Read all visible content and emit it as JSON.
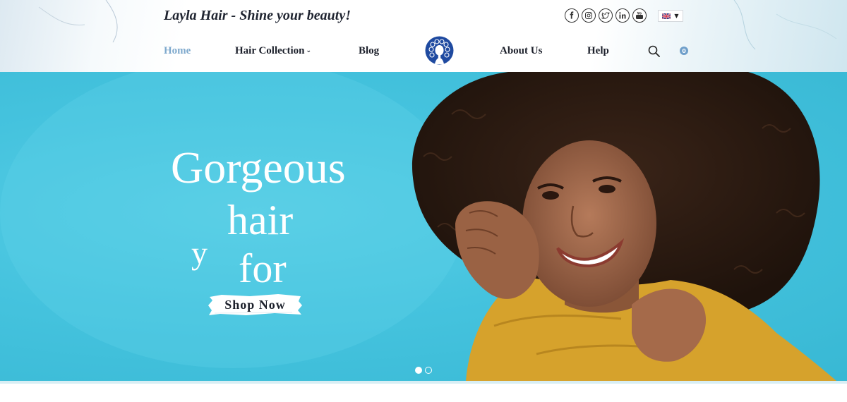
{
  "brand": {
    "tagline": "Layla Hair - Shine your beauty!",
    "logo_icon": "afro-woman-logo-icon",
    "brand_color": "#1f4aa0"
  },
  "social": [
    {
      "icon": "facebook-icon",
      "glyph": "f"
    },
    {
      "icon": "instagram-icon",
      "glyph": ""
    },
    {
      "icon": "twitter-icon",
      "glyph": ""
    },
    {
      "icon": "linkedin-icon",
      "glyph": "in"
    },
    {
      "icon": "youtube-icon",
      "glyph": ""
    }
  ],
  "language": {
    "flag_icon": "uk-flag-icon",
    "caret": "▼"
  },
  "nav": {
    "home": "Home",
    "hair_collection": "Hair Collection",
    "hair_collection_caret": "⌄",
    "blog": "Blog",
    "about": "About Us",
    "help": "Help",
    "active_color": "#7ea9cd"
  },
  "cart": {
    "count": "0",
    "icon": "cart-count-badge"
  },
  "search": {
    "icon": "search-icon"
  },
  "hero": {
    "line1": "Gorgeous",
    "line2": "hair",
    "line3a": "y",
    "line3b": "for",
    "cta": "Shop Now",
    "background": "#45c3de",
    "slides_total": 2,
    "slide_active": 1
  }
}
